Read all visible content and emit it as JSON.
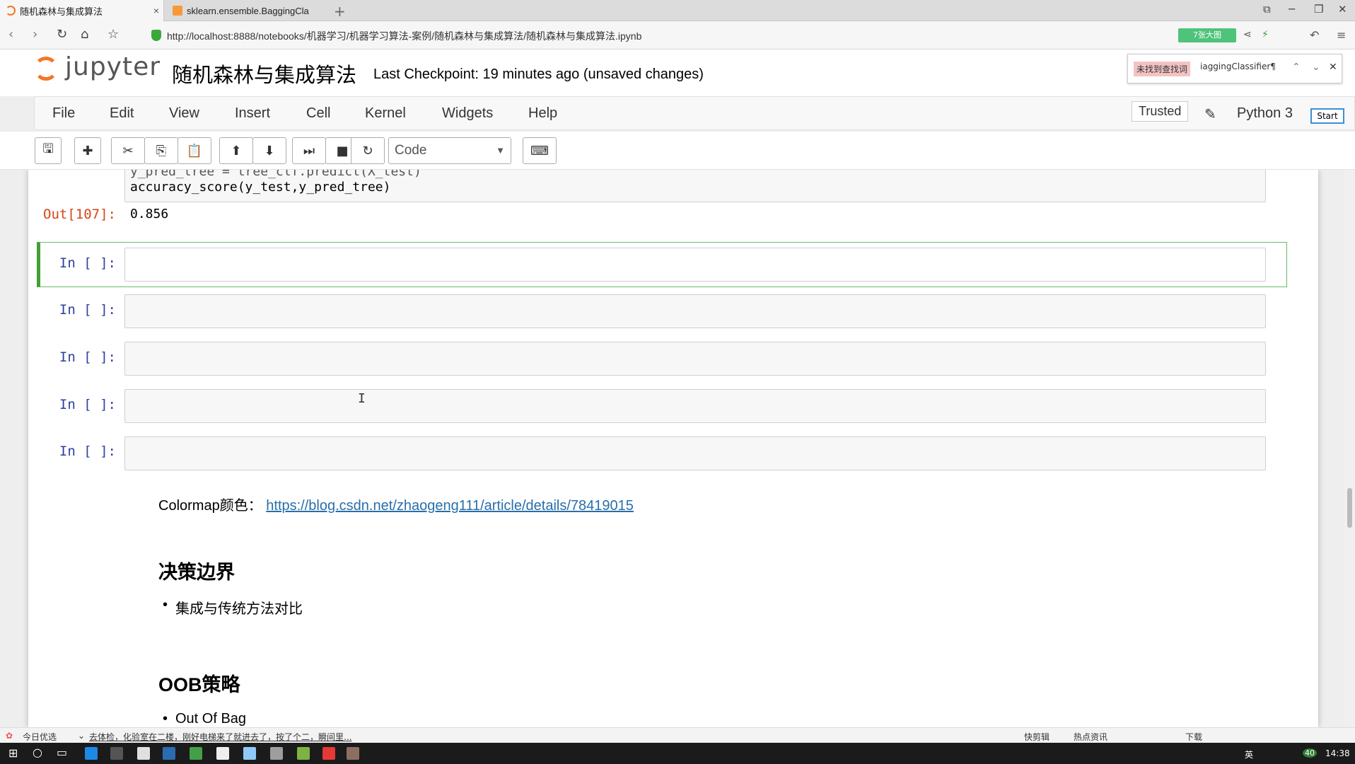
{
  "browser": {
    "tabs": [
      {
        "title": "随机森林与集成算法",
        "close": "×"
      },
      {
        "title": "sklearn.ensemble.BaggingCla"
      }
    ],
    "new_tab": "+",
    "url": "http://localhost:8888/notebooks/机器学习/机器学习算法-案例/随机森林与集成算法/随机森林与集成算法.ipynb",
    "zoom_label": "7张大图",
    "back": "‹",
    "forward": "›",
    "reload": "↻",
    "home": "⌂",
    "bookmark": "☆"
  },
  "find_bar": {
    "status": "未找到查找词",
    "query": "iaggingClassifier¶",
    "up": "⌃",
    "down": "⌄",
    "close": "✕"
  },
  "jupyter": {
    "logo_text": "jupyter",
    "notebook_title": "随机森林与集成算法",
    "checkpoint": "Last Checkpoint: 19 minutes ago (unsaved changes)",
    "menu": [
      "File",
      "Edit",
      "View",
      "Insert",
      "Cell",
      "Kernel",
      "Widgets",
      "Help"
    ],
    "trusted": "Trusted",
    "kernel": "Python 3",
    "start_button": "Start",
    "cell_type": "Code"
  },
  "cells": {
    "prev_code": [
      "y_pred_tree = tree_clf.predict(X_test)",
      "accuracy_score(y_test,y_pred_tree)"
    ],
    "out_prompt": "Out[107]:",
    "out_value": "0.856",
    "empty_prompt": "In [ ]:"
  },
  "markdown": {
    "colormap_label": "Colormap颜色：",
    "colormap_link": "https://blog.csdn.net/zhaogeng111/article/details/78419015",
    "heading1": "决策边界",
    "bullet1": "集成与传统方法对比",
    "heading2": "OOB策略",
    "bullet2": "Out Of Bag"
  },
  "statusbar": {
    "left": "今日优选",
    "news": "去体检，化验室在二楼，刚好电梯来了就进去了，按了个二，瞬间里...",
    "quick_edit": "快剪辑",
    "hot": "热点资讯",
    "download": "下载"
  },
  "taskbar": {
    "ime": "英",
    "clock": "14:38",
    "badge": "40"
  }
}
